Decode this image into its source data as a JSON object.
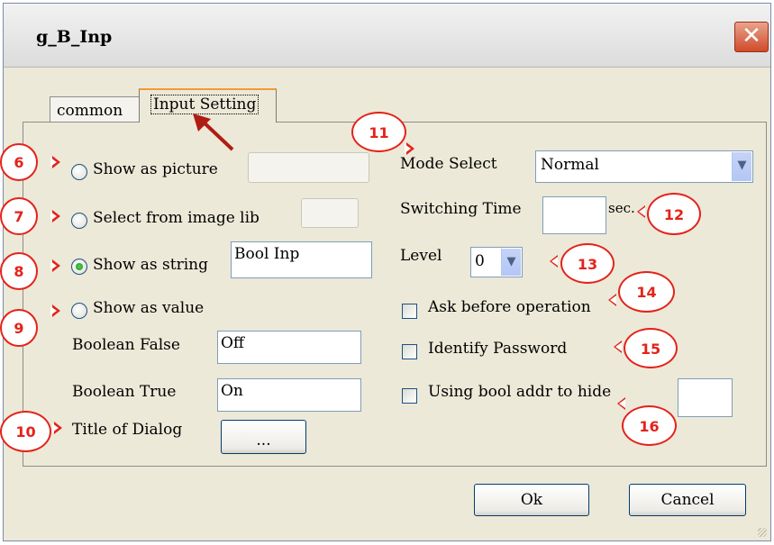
{
  "window": {
    "title": "g_B_Inp",
    "close_glyph": "✕"
  },
  "tabs": [
    "common",
    "Input Setting"
  ],
  "left": {
    "show_picture_label": "Show as picture",
    "select_image_lib_label": "Select from image lib",
    "show_string_label": "Show as string",
    "show_string_value": "Bool Inp",
    "show_value_label": "Show as value",
    "boolean_false_label": "Boolean False",
    "boolean_false_value": "Off",
    "boolean_true_label": "Boolean True",
    "boolean_true_value": "On",
    "title_dialog_label": "Title of Dialog",
    "title_dialog_button": "..."
  },
  "right": {
    "mode_select_label": "Mode Select",
    "mode_select_value": "Normal",
    "switching_time_label": "Switching Time",
    "switching_time_unit": "sec.",
    "level_label": "Level",
    "level_value": "0",
    "ask_before_label": "Ask before operation",
    "identify_password_label": "Identify Password",
    "bool_hide_label": "Using bool addr to hide"
  },
  "footer": {
    "ok_label": "Ok",
    "cancel_label": "Cancel"
  },
  "annotations": [
    "6",
    "7",
    "8",
    "9",
    "10",
    "11",
    "12",
    "13",
    "14",
    "15",
    "16"
  ],
  "colors": {
    "annotation": "#e3231b",
    "dialog_bg": "#ece9d8",
    "close_button": "#cf4b2a"
  },
  "icons": {
    "close": "close-icon",
    "dropdown": "chevron-down-icon",
    "pointer": "arrow-icon"
  }
}
